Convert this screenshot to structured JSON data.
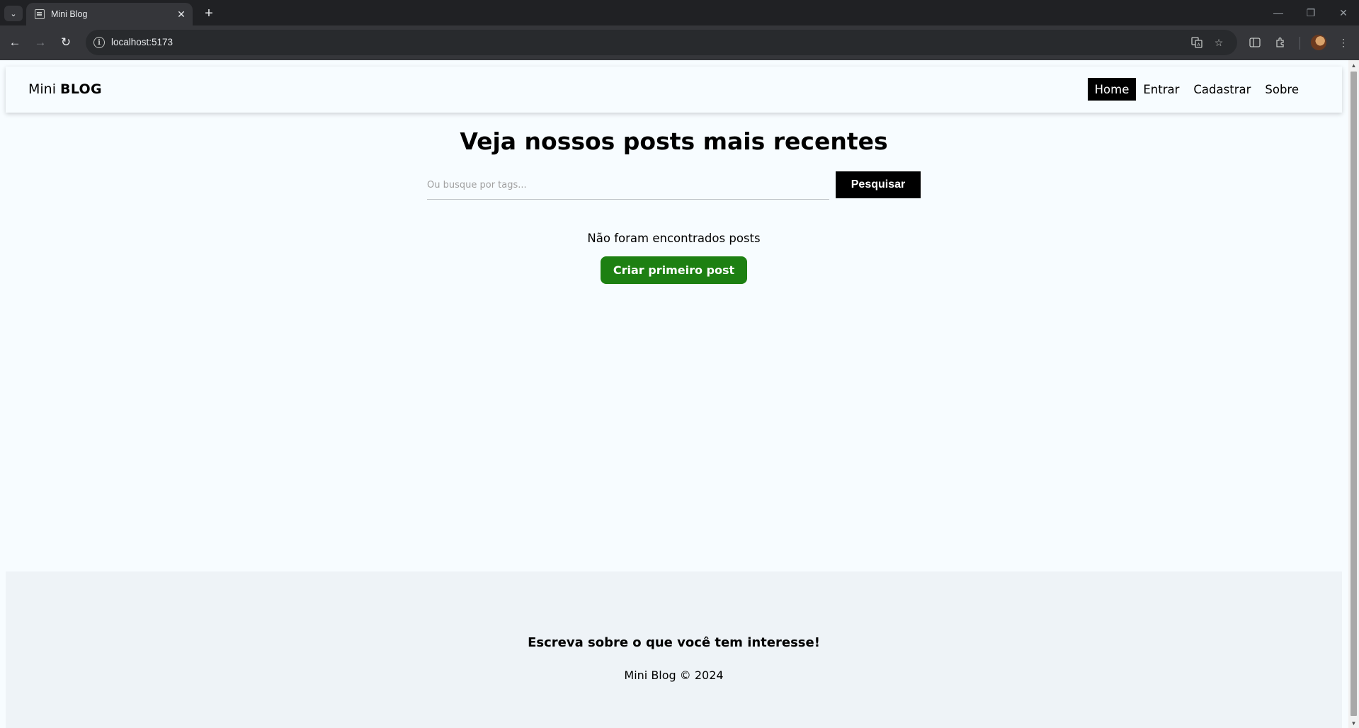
{
  "browser": {
    "tab_list_icon": "chevron-down",
    "tab": {
      "title": "Mini Blog",
      "close_glyph": "✕"
    },
    "new_tab_glyph": "+",
    "window": {
      "minimize": "—",
      "restore": "❐",
      "close": "✕"
    },
    "nav": {
      "back": "←",
      "forward": "→",
      "reload": "↻"
    },
    "url": "localhost:5173",
    "omnibox_icons": [
      "translate-icon",
      "bookmark-star-icon"
    ],
    "toolbar_icons": [
      "sidebar-icon",
      "extensions-icon",
      "profile-avatar",
      "menu-icon"
    ]
  },
  "navbar": {
    "brand_light": "Mini",
    "brand_bold": "BLOG",
    "links": [
      {
        "label": "Home",
        "active": true
      },
      {
        "label": "Entrar",
        "active": false
      },
      {
        "label": "Cadastrar",
        "active": false
      },
      {
        "label": "Sobre",
        "active": false
      }
    ]
  },
  "home": {
    "title": "Veja nossos posts mais recentes",
    "search_placeholder": "Ou busque por tags...",
    "search_button": "Pesquisar",
    "empty_message": "Não foram encontrados posts",
    "create_button": "Criar primeiro post"
  },
  "footer": {
    "tagline": "Escreva sobre o que você tem interesse!",
    "copyright": "Mini Blog © 2024"
  },
  "colors": {
    "page_bg": "#f7fcff",
    "footer_bg": "#eef3f7",
    "accent_black": "#000000",
    "create_button_green": "#1d8012"
  }
}
